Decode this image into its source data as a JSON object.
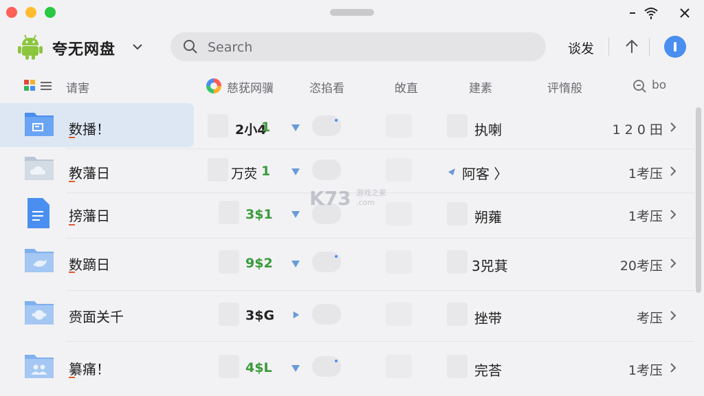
{
  "app": {
    "brand": "夸无网盘"
  },
  "toolbar": {
    "search_placeholder": "Search",
    "action_label": "谈发"
  },
  "columns": {
    "name": "请害",
    "source": "慈莸网骥",
    "type": "恣掐看",
    "size": "敀直",
    "tag": "建素",
    "detail": "评惰般",
    "search_short": "bo"
  },
  "rows": [
    {
      "name": "数播！",
      "size": "2小4",
      "size_suffix": "1",
      "owner": "执喇",
      "date": "1 2 0 田",
      "icon": "document-folder-icon",
      "selected": true
    },
    {
      "name": "教藩日",
      "size": "万荧",
      "size_suffix": "1",
      "owner": "阿客 〉",
      "date": "1考压",
      "icon": "cloud-folder-icon",
      "selected": false
    },
    {
      "name": "搒藩日",
      "size": "3$1",
      "size_suffix": "",
      "owner": "朔蕹",
      "date": "1考压",
      "icon": "doc-file-icon",
      "selected": false
    },
    {
      "name": "数蹢日",
      "size": "9$2",
      "size_suffix": "",
      "owner": "3兕萁",
      "date": "20考压",
      "icon": "bird-folder-icon",
      "selected": false
    },
    {
      "name": "赍面关千",
      "size": "3$G",
      "size_suffix": "",
      "owner": "挫带",
      "date": "考压",
      "icon": "face-folder-icon",
      "selected": false
    },
    {
      "name": "纂痛！",
      "size": "4$L",
      "size_suffix": "",
      "owner": "完荅",
      "date": "1考压",
      "icon": "people-folder-icon",
      "selected": false
    }
  ],
  "watermark": {
    "main": "K73",
    "sub": "游戏之家",
    "domain": ".com"
  },
  "colors": {
    "accent": "#4a8ef0",
    "green": "#3a9a3a",
    "android": "#8cc63f"
  }
}
